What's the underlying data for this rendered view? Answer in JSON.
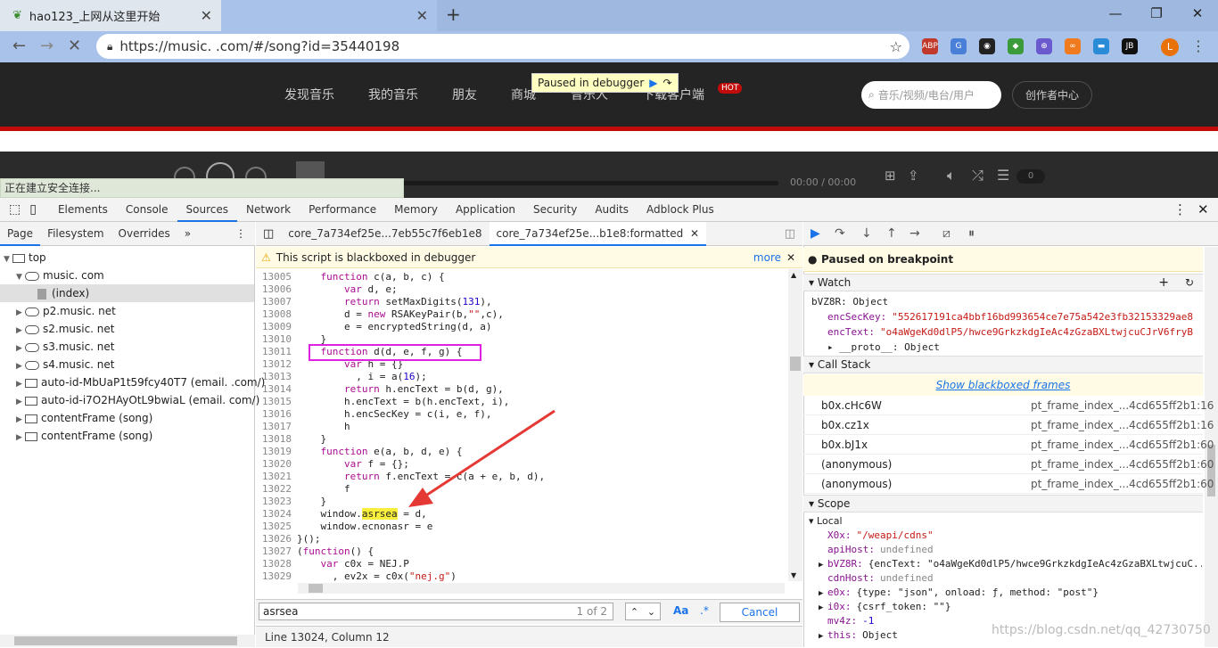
{
  "browser": {
    "tabs": [
      {
        "title": "hao123_上网从这里开始",
        "close": "✕"
      },
      {
        "title": "",
        "close": "✕"
      }
    ],
    "new_tab": "+",
    "window_controls": [
      "—",
      "❐",
      "✕"
    ],
    "url": "https://music.      .com/#/song?id=35440198",
    "extensions": [
      "ABP",
      "G",
      "◉",
      "◆",
      "⊕",
      "∞",
      "▬",
      "JB",
      "L"
    ]
  },
  "site": {
    "nav": [
      "发现音乐",
      "我的音乐",
      "朋友",
      "商城",
      "音乐人",
      "下载客户端"
    ],
    "hot_badge": "HOT",
    "search_placeholder": "音乐/视频/电台/用户",
    "creator_button": "创作者中心",
    "paused_label": "Paused in debugger",
    "player_time": "00:00 / 00:00",
    "player_count": "0",
    "status_text": "正在建立安全连接..."
  },
  "devtools": {
    "tabs": [
      "Elements",
      "Console",
      "Sources",
      "Network",
      "Performance",
      "Memory",
      "Application",
      "Security",
      "Audits",
      "Adblock Plus"
    ],
    "active_tab": "Sources",
    "navigator": {
      "tabs": [
        "Page",
        "Filesystem",
        "Overrides",
        "»"
      ],
      "tree": [
        {
          "label": "top",
          "indent": 0,
          "kind": "frame",
          "open": true
        },
        {
          "label": "music.       com",
          "indent": 1,
          "kind": "cloud",
          "open": true
        },
        {
          "label": "(index)",
          "indent": 2,
          "kind": "file",
          "open": false,
          "selected": true
        },
        {
          "label": "p2.music.        net",
          "indent": 1,
          "kind": "cloud",
          "open": false
        },
        {
          "label": "s2.music.        net",
          "indent": 1,
          "kind": "cloud",
          "open": false
        },
        {
          "label": "s3.music.        net",
          "indent": 1,
          "kind": "cloud",
          "open": false
        },
        {
          "label": "s4.music.        net",
          "indent": 1,
          "kind": "cloud",
          "open": false
        },
        {
          "label": "auto-id-MbUaP1t59fcy40T7 (email.        .com/)",
          "indent": 1,
          "kind": "frame",
          "open": false
        },
        {
          "label": "auto-id-i7O2HAyOtL9bwiaL (email.        com/)",
          "indent": 1,
          "kind": "frame",
          "open": false
        },
        {
          "label": "contentFrame (song)",
          "indent": 1,
          "kind": "frame",
          "open": false
        },
        {
          "label": "contentFrame (song)",
          "indent": 1,
          "kind": "frame",
          "open": false
        }
      ]
    },
    "editor": {
      "tabs": [
        {
          "label": "core_7a734ef25e...7eb55c7f6eb1e8",
          "active": false
        },
        {
          "label": "core_7a734ef25e...b1e8:formatted",
          "active": true
        }
      ],
      "blackbox_notice": "This script is blackboxed in debugger",
      "more_link": "more",
      "lines": [
        {
          "n": "13005",
          "t": "    function c(a, b, c) {"
        },
        {
          "n": "13006",
          "t": "        var d, e;"
        },
        {
          "n": "13007",
          "t": "        return setMaxDigits(131),"
        },
        {
          "n": "13008",
          "t": "        d = new RSAKeyPair(b,\"\",c),"
        },
        {
          "n": "13009",
          "t": "        e = encryptedString(d, a)"
        },
        {
          "n": "13010",
          "t": "    }"
        },
        {
          "n": "13011",
          "t": "    function d(d, e, f, g) {"
        },
        {
          "n": "13012",
          "t": "        var h = {}"
        },
        {
          "n": "13013",
          "t": "          , i = a(16);"
        },
        {
          "n": "13014",
          "t": "        return h.encText = b(d, g),"
        },
        {
          "n": "13015",
          "t": "        h.encText = b(h.encText, i),"
        },
        {
          "n": "13016",
          "t": "        h.encSecKey = c(i, e, f),"
        },
        {
          "n": "13017",
          "t": "        h"
        },
        {
          "n": "13018",
          "t": "    }"
        },
        {
          "n": "13019",
          "t": "    function e(a, b, d, e) {"
        },
        {
          "n": "13020",
          "t": "        var f = {};"
        },
        {
          "n": "13021",
          "t": "        return f.encText = c(a + e, b, d),"
        },
        {
          "n": "13022",
          "t": "        f"
        },
        {
          "n": "13023",
          "t": "    }"
        },
        {
          "n": "13024",
          "t": "    window.asrsea = d,"
        },
        {
          "n": "13025",
          "t": "    window.ecnonasr = e"
        },
        {
          "n": "13026",
          "t": "}();"
        },
        {
          "n": "13027",
          "t": "(function() {"
        },
        {
          "n": "13028",
          "t": "    var c0x = NEJ.P"
        },
        {
          "n": "13029",
          "t": "      , ev2x = c0x(\"nej.g\")"
        },
        {
          "n": "13030",
          "t": ""
        }
      ],
      "highlight_word": "asrsea",
      "search": {
        "query": "asrsea",
        "count": "1 of 2",
        "case": "Aa",
        "regex": ".*",
        "cancel": "Cancel"
      },
      "status": "Line 13024, Column 12"
    },
    "debugger": {
      "paused_text": "Paused on breakpoint",
      "watch_title": "Watch",
      "watch": [
        {
          "text": "bVZ8R: Object",
          "indent": 0
        },
        {
          "key": "encSecKey:",
          "val": "\"552617191ca4bbf16bd993654ce7e75a542e3fb32153329ae8...",
          "indent": 1
        },
        {
          "key": "encText:",
          "val": "\"o4aWgeKd0dlP5/hwce9GrkzkdgIeAc4zGzaBXLtwjcuCJrV6fryB...",
          "indent": 1
        },
        {
          "text": "▸ __proto__: Object",
          "indent": 1
        }
      ],
      "callstack_title": "Call Stack",
      "show_blackboxed": "Show blackboxed frames",
      "frames": [
        {
          "fn": "b0x.cHc6W",
          "loc": "pt_frame_index_...4cd655ff2b1:16"
        },
        {
          "fn": "b0x.cz1x",
          "loc": "pt_frame_index_...4cd655ff2b1:16"
        },
        {
          "fn": "b0x.bJ1x",
          "loc": "pt_frame_index_...4cd655ff2b1:60"
        },
        {
          "fn": "(anonymous)",
          "loc": "pt_frame_index_...4cd655ff2b1:60"
        },
        {
          "fn": "(anonymous)",
          "loc": "pt_frame_index_...4cd655ff2b1:60"
        }
      ],
      "scope_title": "Scope",
      "local_title": "Local",
      "scope": [
        {
          "key": "X0x:",
          "val": "\"/weapi/cdns\"",
          "tri": false
        },
        {
          "key": "apiHost:",
          "val": "undefined",
          "tri": false
        },
        {
          "key": "bVZ8R:",
          "val": "{encText: \"o4aWgeKd0dlP5/hwce9GrkzkdgIeAc4zGzaBXLtwjcuC...",
          "tri": true
        },
        {
          "key": "cdnHost:",
          "val": "undefined",
          "tri": false
        },
        {
          "key": "e0x:",
          "val": "{type: \"json\", onload: ƒ, method: \"post\"}",
          "tri": true
        },
        {
          "key": "i0x:",
          "val": "{csrf_token: \"\"}",
          "tri": true
        },
        {
          "key": "mv4z:",
          "val": "-1",
          "tri": false
        },
        {
          "key": "this:",
          "val": "Object",
          "tri": true
        }
      ],
      "watermark": "https://blog.csdn.net/qq_42730750"
    }
  }
}
